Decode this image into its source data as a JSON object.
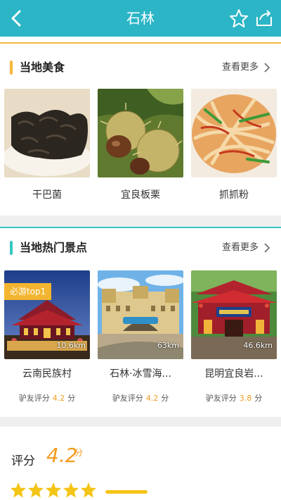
{
  "header": {
    "title": "石林",
    "back_icon": "chevron-left-icon",
    "favorite_icon": "star-outline-icon",
    "share_icon": "share-icon"
  },
  "food": {
    "title": "当地美食",
    "more": "查看更多",
    "accent": "#f4b73a",
    "items": [
      {
        "name": "干巴菌"
      },
      {
        "name": "宜良板栗"
      },
      {
        "name": "抓抓粉"
      }
    ]
  },
  "spots": {
    "title": "当地热门景点",
    "more": "查看更多",
    "accent": "#35c7c1",
    "items": [
      {
        "name": "云南民族村",
        "distance": "10.6km",
        "tag": "必游top1",
        "rating_label": "驴友评分",
        "rating": "4.2",
        "unit": "分"
      },
      {
        "name": "石林·冰雪海...",
        "distance": "63km",
        "rating_label": "驴友评分",
        "rating": "4.2",
        "unit": "分"
      },
      {
        "name": "昆明宜良岩...",
        "distance": "46.6km",
        "rating_label": "驴友评分",
        "rating": "3.8",
        "unit": "分"
      }
    ]
  },
  "score": {
    "label": "评分",
    "value": "4.2",
    "unit": "分",
    "stars": 5
  },
  "colors": {
    "primary": "#2bb5c6",
    "rating": "#f39c1f",
    "star": "#f4c417"
  }
}
